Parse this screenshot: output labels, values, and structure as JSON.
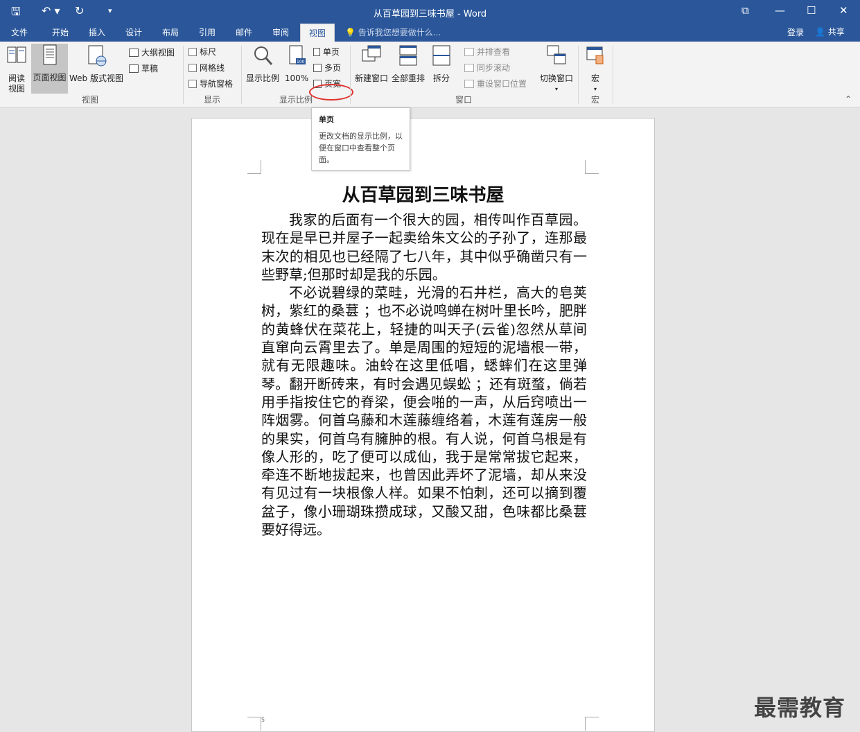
{
  "window": {
    "title": "从百草园到三味书屋 - Word"
  },
  "qat": {
    "save": "🖫",
    "undo": "↶ ▾",
    "redo": "↻",
    "customize": "▾"
  },
  "winctrl": {
    "restore": "⧉",
    "minimize": "—",
    "maximize": "☐",
    "close": "✕"
  },
  "tabs": [
    "文件",
    "开始",
    "插入",
    "设计",
    "布局",
    "引用",
    "邮件",
    "审阅",
    "视图"
  ],
  "active_tab": "视图",
  "tellme": "告诉我您想要做什么...",
  "account": {
    "login": "登录",
    "share": "共享"
  },
  "ribbon": {
    "views": {
      "read": "阅读\n视图",
      "print": "页面视图",
      "web": "Web 版式视图",
      "outline": "大纲视图",
      "draft": "草稿",
      "group": "视图"
    },
    "show": {
      "ruler": "标尺",
      "gridlines": "网格线",
      "nav": "导航窗格",
      "group": "显示"
    },
    "zoom": {
      "zoom": "显示比例",
      "hundred": "100%",
      "one_page": "单页",
      "multi": "多页",
      "width": "页宽",
      "group": "显示比例"
    },
    "window": {
      "new": "新建窗口",
      "arrange": "全部重排",
      "split": "拆分",
      "side": "并排查看",
      "sync": "同步滚动",
      "reset": "重设窗口位置",
      "switch": "切换窗口",
      "group": "窗口"
    },
    "macros": {
      "macro": "宏",
      "group": "宏"
    }
  },
  "tooltip": {
    "title": "单页",
    "desc": "更改文档的显示比例，以便在窗口中查看整个页面。"
  },
  "document": {
    "title": "从百草园到三味书屋",
    "p1": "我家的后面有一个很大的园，相传叫作百草园。现在是早已并屋子一起卖给朱文公的子孙了，连那最末次的相见也已经隔了七八年，其中似乎确凿只有一些野草;但那时却是我的乐园。",
    "p2": "不必说碧绿的菜畦，光滑的石井栏，高大的皂荚树，紫红的桑葚 ；也不必说鸣蝉在树叶里长吟，肥胖的黄蜂伏在菜花上，轻捷的叫天子(云雀)忽然从草间直窜向云霄里去了。单是周围的短短的泥墙根一带，就有无限趣味。油蛉在这里低唱，蟋蟀们在这里弹琴。翻开断砖来，有时会遇见蜈蚣 ；还有斑蝥，倘若用手指按住它的脊梁，便会啪的一声，从后窍喷出一阵烟雾。何首乌藤和木莲藤缠络着，木莲有莲房一般的果实，何首乌有臃肿的根。有人说，何首乌根是有像人形的，吃了便可以成仙，我于是常常拔它起来，牵连不断地拔起来，也曾因此弄坏了泥墙，却从来没有见过有一块根像人样。如果不怕刺，还可以摘到覆盆子，像小珊瑚珠攒成球，又酸又甜，色味都比桑葚要好得远。",
    "page_number": "5"
  },
  "watermark": "最需教育"
}
